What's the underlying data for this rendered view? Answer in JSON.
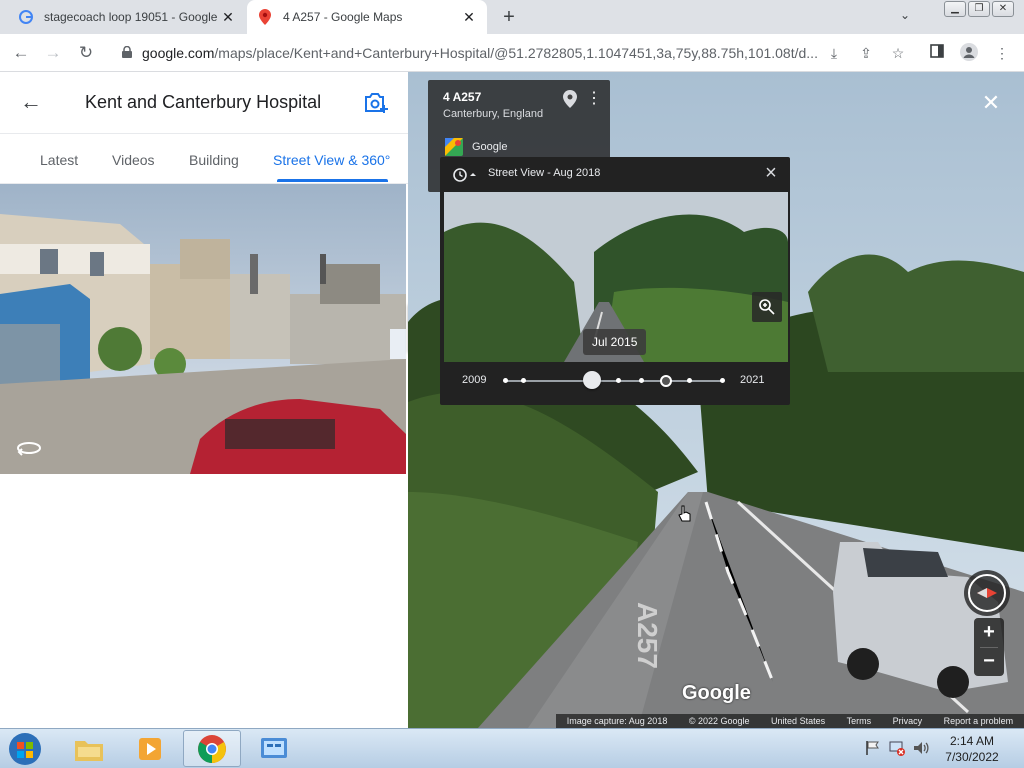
{
  "browser": {
    "tabs": [
      {
        "title": "stagecoach loop 19051 - Google",
        "active": false,
        "favicon": "google-g-icon"
      },
      {
        "title": "4 A257 - Google Maps",
        "active": true,
        "favicon": "google-maps-pin-icon"
      }
    ],
    "url_host": "google.com",
    "url_rest": "/maps/place/Kent+and+Canterbury+Hospital/@51.2782805,1.1047451,3a,75y,88.75h,101.08t/d...",
    "window_buttons": [
      "minimize",
      "restore",
      "close"
    ]
  },
  "left_panel": {
    "title": "Kent and Canterbury Hospital",
    "tabs": [
      "Latest",
      "Videos",
      "Building",
      "Street View & 360°"
    ],
    "active_tab": "Street View & 360°"
  },
  "street_view": {
    "info_card": {
      "title": "4 A257",
      "subtitle": "Canterbury, England",
      "attribution": "Google"
    },
    "time_machine": {
      "label": "Street View - Aug 2018",
      "selected_date": "Jul 2015",
      "start_year": "2009",
      "end_year": "2021",
      "slider_position_fraction": 0.4
    },
    "logo": "Google",
    "footer": [
      "Image capture: Aug 2018",
      "© 2022 Google",
      "United States",
      "Terms",
      "Privacy",
      "Report a problem"
    ]
  },
  "taskbar": {
    "time": "2:14 AM",
    "date": "7/30/2022"
  },
  "colors": {
    "accent": "#1a73e8",
    "panel_dark": "#222222"
  }
}
